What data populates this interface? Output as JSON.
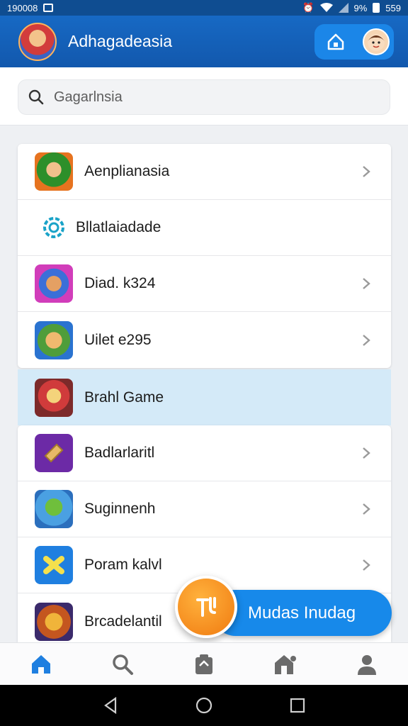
{
  "status_bar": {
    "time": "190008",
    "battery": "9%",
    "extra": "559"
  },
  "app_bar": {
    "title": "Adhagadeasia"
  },
  "search": {
    "placeholder": "Gagarlnsia"
  },
  "list": [
    {
      "label": "Aenplianasia",
      "icon": "game-character-icon",
      "chevron": true
    },
    {
      "label": "Bllatlaiadade",
      "icon": "gear-icon",
      "chevron": false
    },
    {
      "label": "Diad. k324",
      "icon": "game-character-icon",
      "chevron": true
    },
    {
      "label": "Uilet e295",
      "icon": "game-character-icon",
      "chevron": true
    },
    {
      "label": "Brahl Game",
      "icon": "game-character-icon",
      "chevron": false,
      "highlighted": true
    },
    {
      "label": "Badlarlaritl",
      "icon": "ticket-icon",
      "chevron": true
    },
    {
      "label": "Suginnenh",
      "icon": "game-character-icon",
      "chevron": true
    },
    {
      "label": "Poram kalvl",
      "icon": "puzzle-icon",
      "chevron": true
    },
    {
      "label": "Brcadelantil",
      "icon": "game-character-icon",
      "chevron": false
    }
  ],
  "fab": {
    "label": "Mudas Inudag"
  },
  "bottom_nav": [
    "home-icon",
    "search-icon",
    "bag-icon",
    "store-icon",
    "person-icon"
  ],
  "colors": {
    "primary": "#1565c0",
    "accent": "#1789ea",
    "fab_orange": "#f58a15",
    "highlight": "#d4eaf8"
  }
}
